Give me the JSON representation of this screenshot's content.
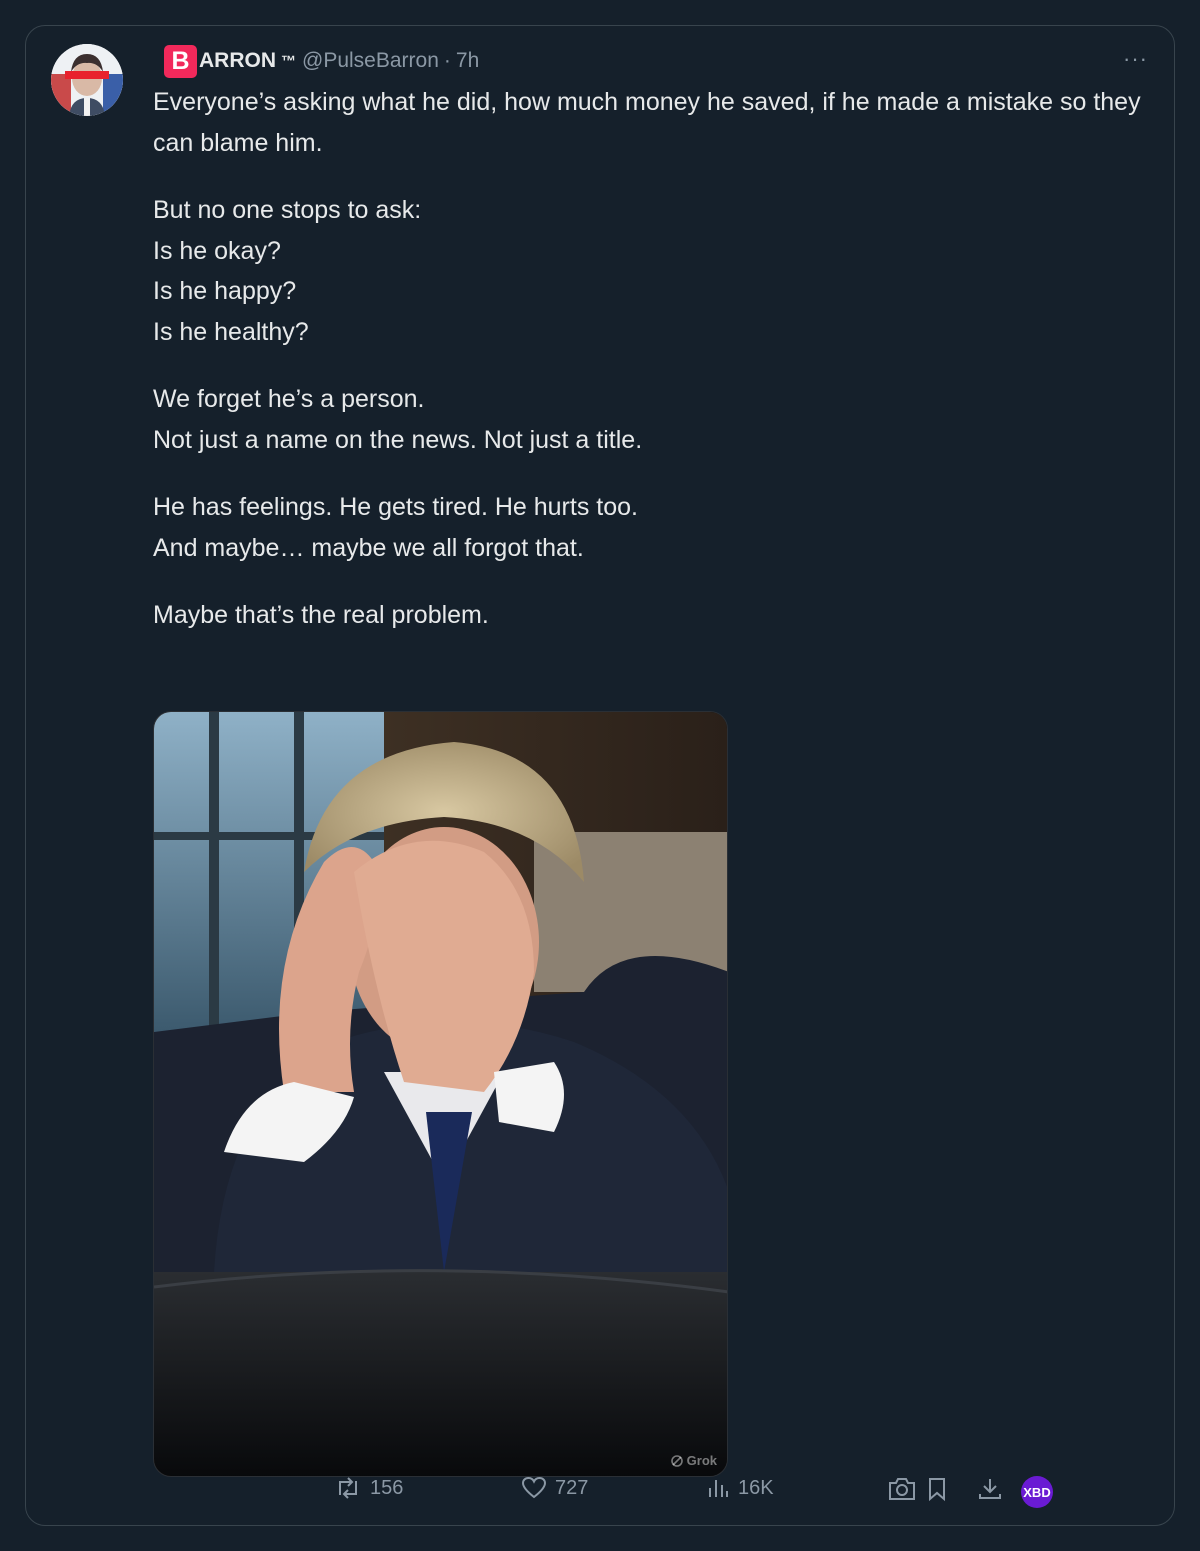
{
  "post": {
    "author": {
      "brand_letter": "B",
      "display_name": "ARRON",
      "tm": "™",
      "handle": "@PulseBarron",
      "separator": "·",
      "time": "7h"
    },
    "more_label": "···",
    "paragraphs": [
      "Everyone’s asking what he did, how much money he saved, if he made a mistake so they can blame him.",
      "But no one stops to ask:\nIs he okay?\nIs he happy?\nIs he healthy?",
      "We forget he’s a person.\nNot just a name on the news. Not just a title.",
      "He has feelings. He gets tired. He hurts too.\nAnd maybe… maybe we all forgot that.",
      "Maybe that’s the real problem."
    ],
    "media": {
      "watermark": "Grok"
    },
    "actions": {
      "retweets": "156",
      "likes": "727",
      "views": "16K",
      "extension_badge": "XBD"
    }
  },
  "colors": {
    "background": "#15202b",
    "text": "#e7e9ea",
    "muted": "#8b98a5",
    "brand": "#f2295b",
    "badge": "#6a1bd3"
  },
  "icons": [
    "more-icon",
    "retweet-icon",
    "like-icon",
    "views-icon",
    "camera-icon",
    "bookmark-icon",
    "download-icon"
  ]
}
